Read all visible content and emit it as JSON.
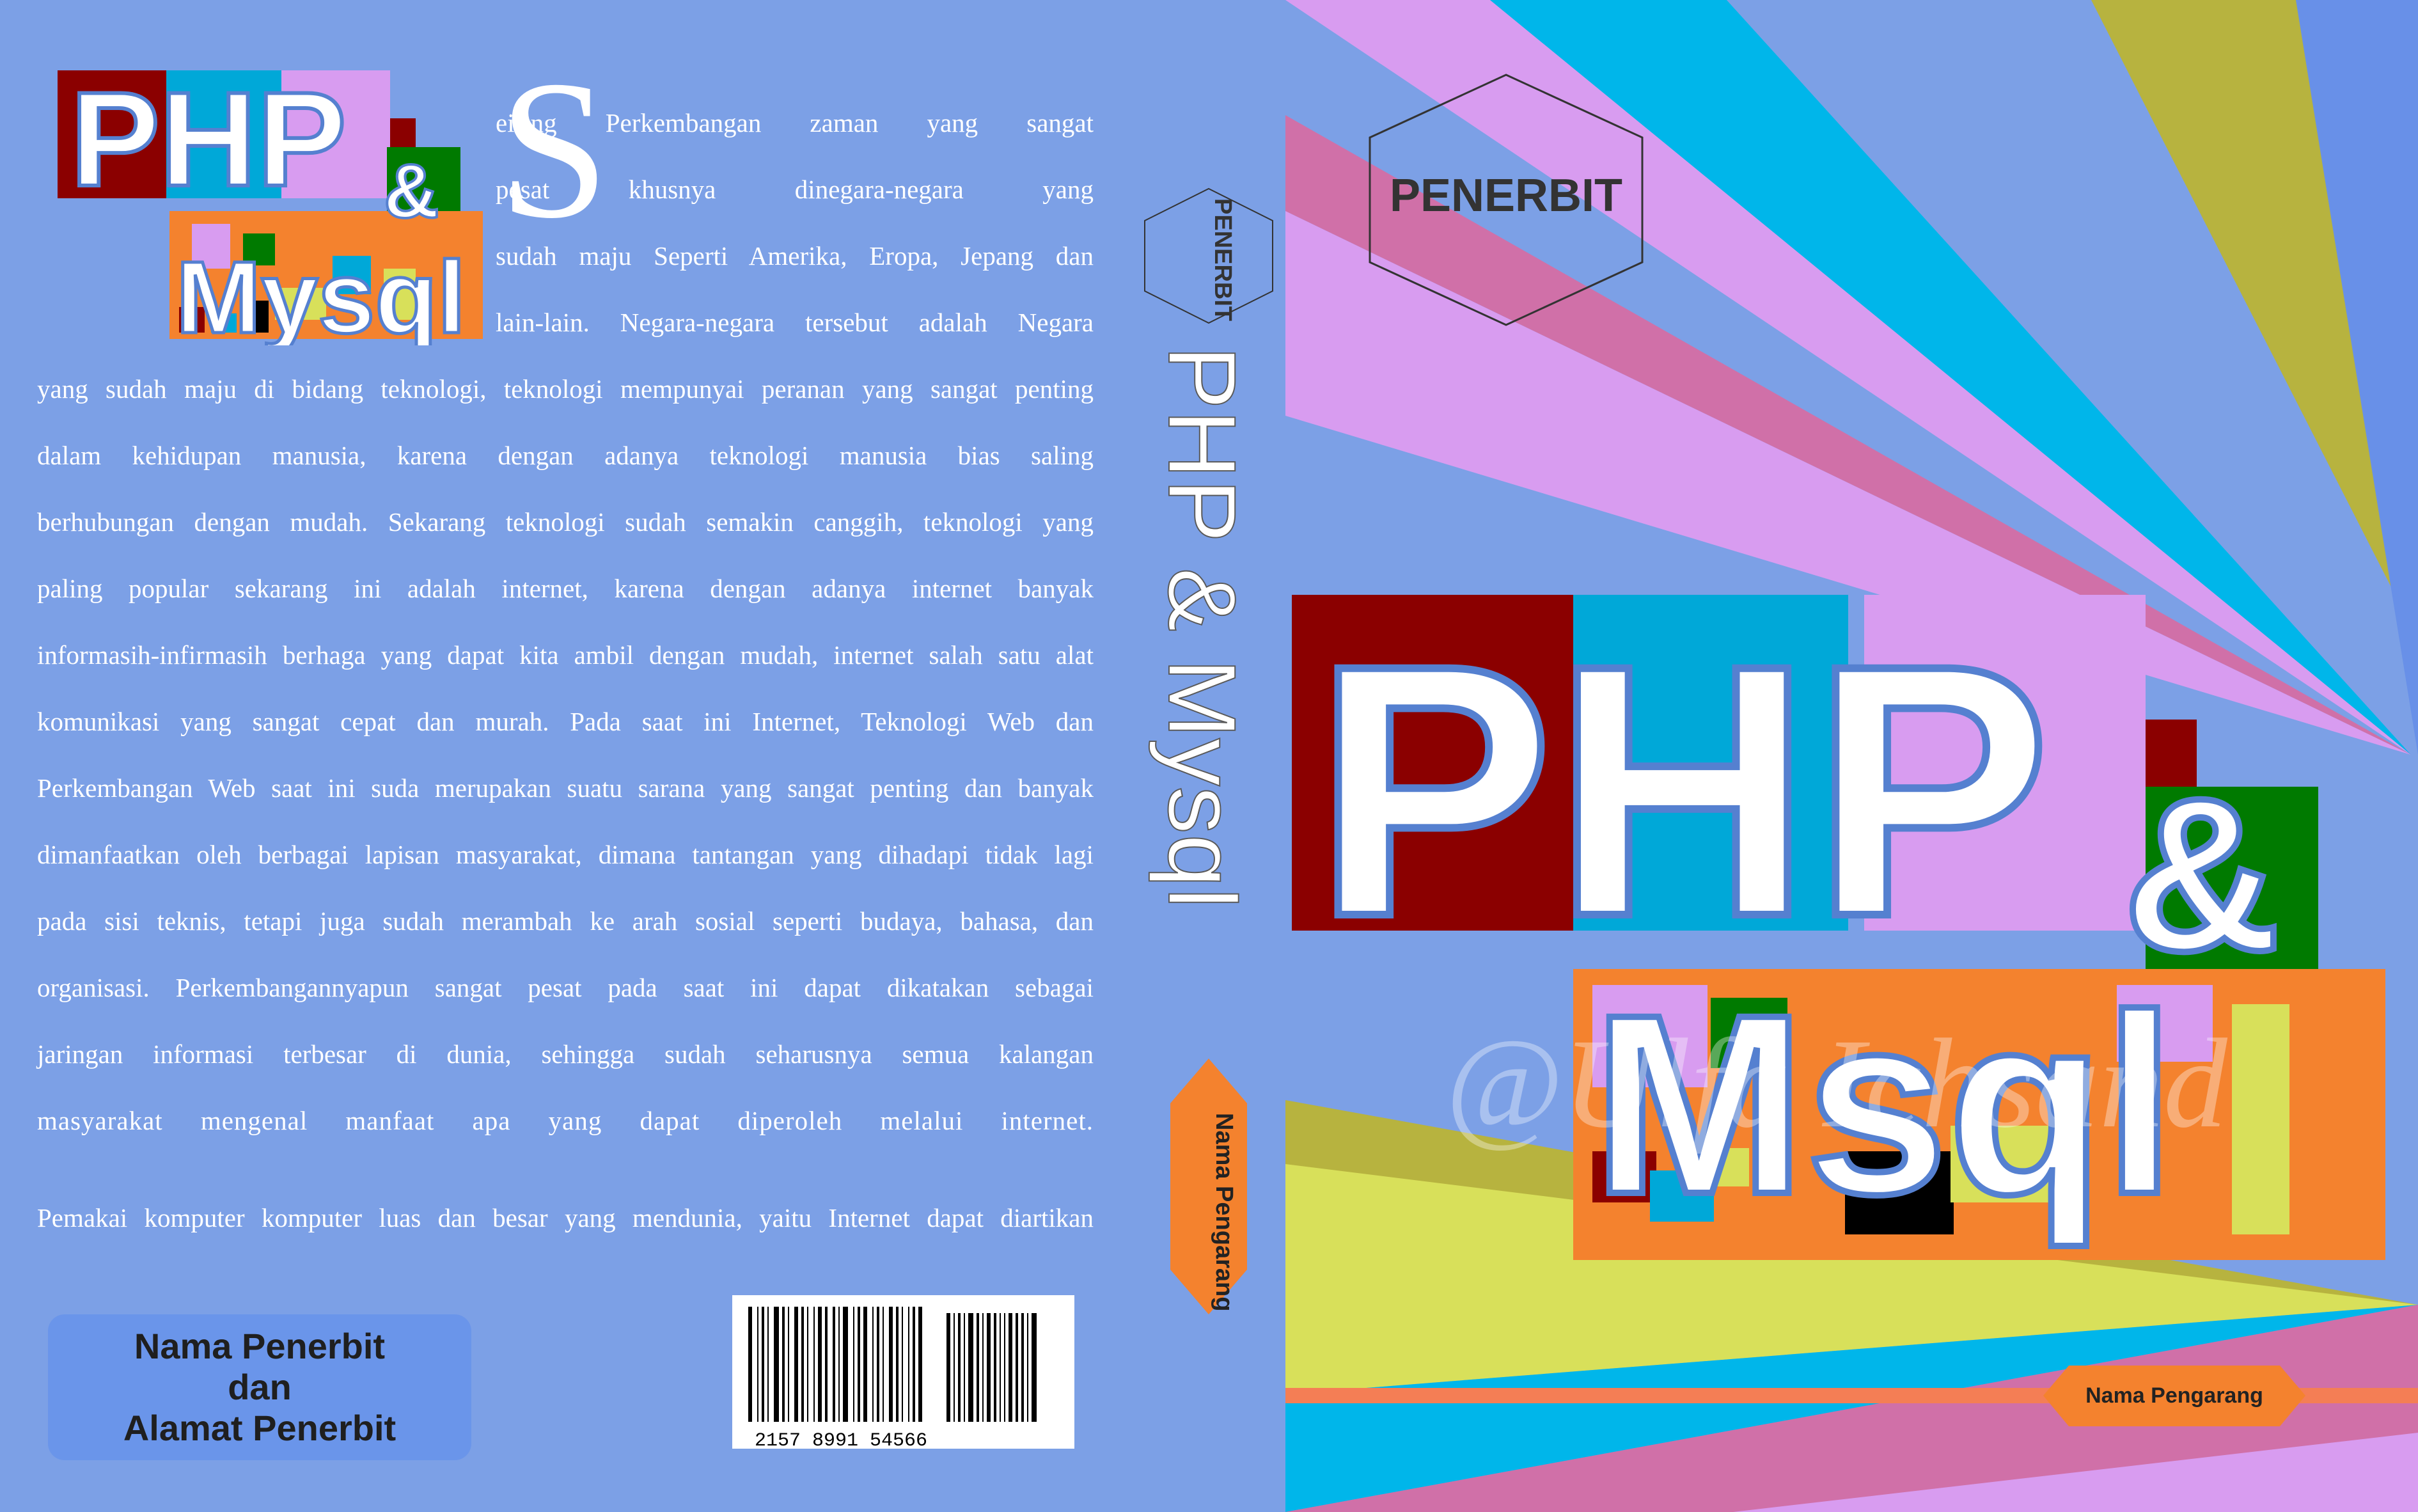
{
  "back": {
    "logo": {
      "line1": "PHP",
      "amp": "&",
      "line2": "Mysql"
    },
    "dropcap": "S",
    "paragraph_lines": [
      "eiring Perkembangan zaman yang sangat",
      "pesat khusnya dinegara-negara yang",
      "sudah maju Seperti Amerika, Eropa, Jepang dan",
      "lain-lain. Negara-negara tersebut adalah Negara",
      "yang sudah maju di bidang teknologi, teknologi mempunyai peranan yang sangat penting",
      "dalam kehidupan manusia, karena dengan adanya teknologi manusia bias saling",
      "berhubungan dengan mudah. Sekarang teknologi sudah semakin canggih, teknologi yang",
      "paling popular sekarang ini adalah internet, karena dengan adanya internet banyak",
      "informasih-infirmasih berhaga yang dapat kita ambil dengan mudah, internet salah satu alat",
      "komunikasi yang sangat cepat dan murah. Pada saat ini Internet, Teknologi Web dan",
      "Perkembangan Web saat ini suda merupakan suatu sarana yang sangat penting dan banyak",
      "dimanfaatkan oleh berbagai lapisan masyarakat, dimana tantangan yang dihadapi tidak lagi",
      "pada sisi teknis, tetapi juga sudah merambah ke arah sosial seperti budaya, bahasa, dan",
      "organisasi. Perkembangannyapun sangat pesat pada saat ini dapat dikatakan sebagai",
      "jaringan informasi terbesar di dunia, sehingga sudah seharusnya semua kalangan",
      "masyarakat mengenal manfaat apa yang dapat diperoleh melalui internet."
    ],
    "last_line": "Pemakai komputer komputer luas dan besar yang mendunia, yaitu Internet dapat diartikan",
    "publisher": {
      "line1": "Nama Penerbit",
      "line2": "dan",
      "line3": "Alamat Penerbit"
    },
    "barcode_digits": "2157 8991   54566"
  },
  "spine": {
    "publisher": "PENERBIT",
    "title": "PHP & Mysql",
    "author": "Nama Pengarang"
  },
  "front": {
    "publisher": "PENERBIT",
    "title_line1": "PHP",
    "amp": "&",
    "title_line2": "Msql",
    "author": "Nama Pengarang",
    "watermark": "@Ulfa Ichsand"
  },
  "colors": {
    "background": "#7ca0e6",
    "maroon": "#8b0000",
    "cyan": "#00a8d8",
    "lilac": "#d89cf0",
    "green": "#007a00",
    "orange": "#f4822e",
    "pink": "#d070a8",
    "olive": "#b7b33f"
  }
}
